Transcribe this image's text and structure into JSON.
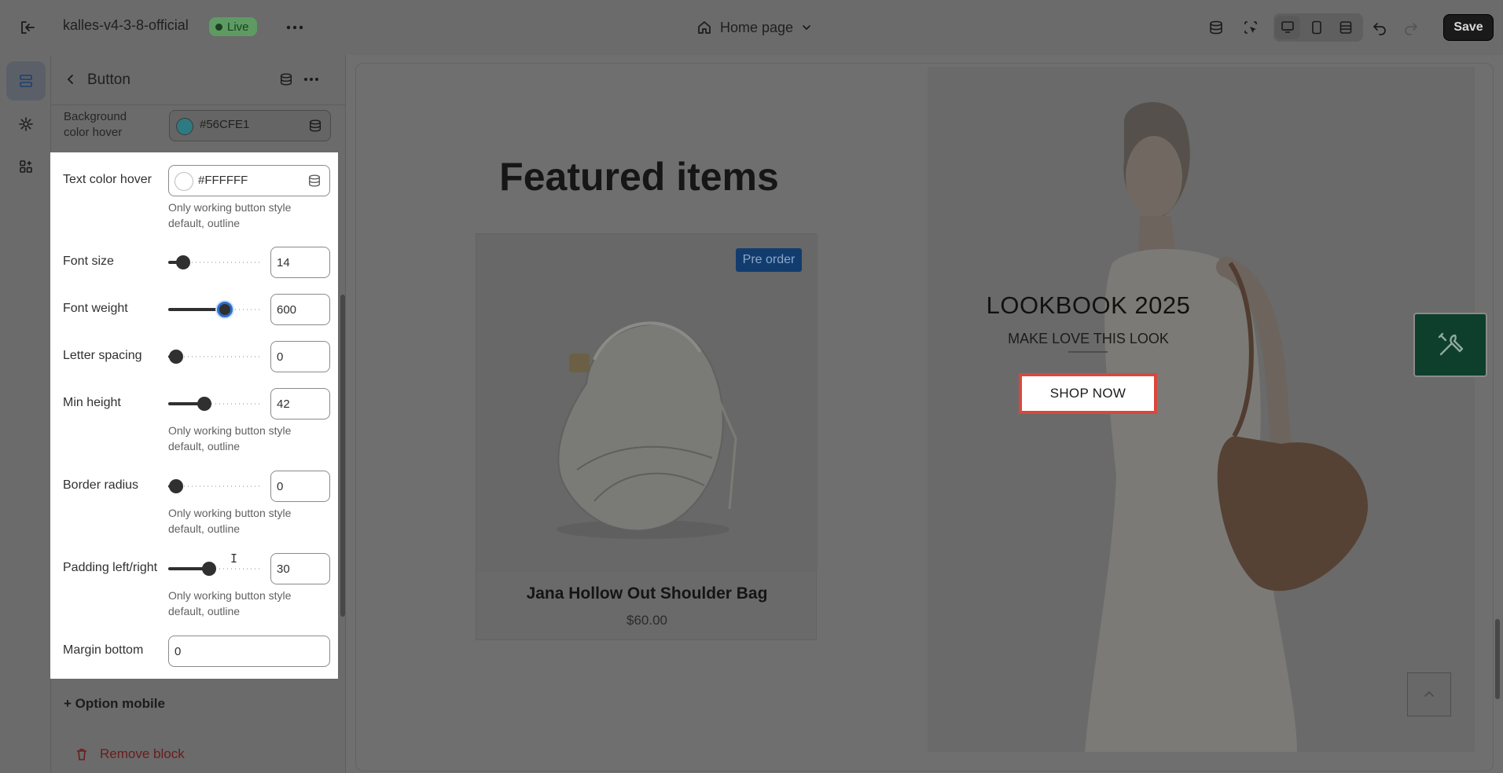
{
  "topbar": {
    "store_name": "kalles-v4-3-8-official",
    "live_badge": "Live",
    "page_selector": "Home page",
    "save_label": "Save"
  },
  "panel": {
    "title": "Button",
    "background_hover": {
      "label": "Background color hover",
      "value": "#56CFE1"
    },
    "option_mobile": "+ Option mobile",
    "remove_block": "Remove block"
  },
  "settings": {
    "help_text": "Only working button style default, outline",
    "text_color_hover": {
      "label": "Text color hover",
      "value": "#FFFFFF"
    },
    "font_size": {
      "label": "Font size",
      "value": "14"
    },
    "font_weight": {
      "label": "Font weight",
      "value": "600"
    },
    "letter_spacing": {
      "label": "Letter spacing",
      "value": "0"
    },
    "min_height": {
      "label": "Min height",
      "value": "42"
    },
    "border_radius": {
      "label": "Border radius",
      "value": "0"
    },
    "padding_lr": {
      "label": "Padding left/right",
      "value": "30"
    },
    "margin_bottom": {
      "label": "Margin bottom",
      "value": "0"
    }
  },
  "slider_positions": {
    "font_size": 0.16,
    "font_weight": 0.6,
    "letter_spacing": 0.08,
    "min_height": 0.38,
    "border_radius": 0.08,
    "padding_lr": 0.43
  },
  "preview": {
    "featured_title": "Featured items",
    "product": {
      "badge": "Pre order",
      "name": "Jana Hollow Out Shoulder Bag",
      "price": "$60.00"
    },
    "lookbook": {
      "title": "LOOKBOOK 2025",
      "subtitle": "MAKE LOVE THIS LOOK",
      "button": "SHOP NOW"
    }
  },
  "colors": {
    "save_bg": "#1a1a1a",
    "live_badge": "#5d9b63",
    "focus_ring": "#2c6ecb",
    "shop_button_outline": "#d9473d",
    "preorder_badge": "#133c6e",
    "tools_button": "#0d3f2c"
  },
  "icons": {
    "exit": "exit-icon",
    "more": "more-horizontal-icon",
    "home": "home-icon",
    "chevron": "chevron-down-icon",
    "sections": "sections-icon",
    "settings": "gear-icon",
    "apps": "apps-icon",
    "back": "arrow-left-icon",
    "database": "database-icon",
    "inspector": "inspector-icon",
    "desktop": "desktop-icon",
    "mobile": "mobile-icon",
    "fullwidth": "fullwidth-icon",
    "undo": "undo-icon",
    "redo": "redo-icon",
    "trash": "trash-icon",
    "tools": "tools-icon",
    "scroll_top": "chevron-up-icon"
  }
}
